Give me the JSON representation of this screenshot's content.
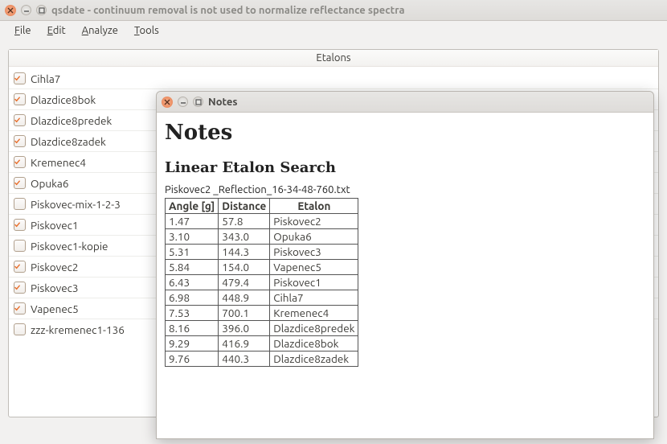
{
  "main_window": {
    "title": "qsdate - continuum removal is not used to normalize reflectance spectra",
    "menu": {
      "file": "File",
      "edit": "Edit",
      "analyze": "Analyze",
      "tools": "Tools"
    },
    "panel_title": "Etalons",
    "etalons": [
      {
        "label": "Cihla7",
        "checked": true
      },
      {
        "label": "Dlazdice8bok",
        "checked": true
      },
      {
        "label": "Dlazdice8predek",
        "checked": true
      },
      {
        "label": "Dlazdice8zadek",
        "checked": true
      },
      {
        "label": "Kremenec4",
        "checked": true
      },
      {
        "label": "Opuka6",
        "checked": true
      },
      {
        "label": "Piskovec-mix-1-2-3",
        "checked": false
      },
      {
        "label": "Piskovec1",
        "checked": true
      },
      {
        "label": "Piskovec1-kopie",
        "checked": false
      },
      {
        "label": "Piskovec2",
        "checked": true
      },
      {
        "label": "Piskovec3",
        "checked": true
      },
      {
        "label": "Vapenec5",
        "checked": true
      },
      {
        "label": "zzz-kremenec1-136",
        "checked": false
      }
    ]
  },
  "dialog": {
    "title": "Notes",
    "heading": "Notes",
    "subheading": "Linear Etalon Search",
    "filename": "Piskovec2 _Reflection_16-34-48-760.txt",
    "columns": [
      "Angle [g]",
      "Distance",
      "Etalon"
    ],
    "rows": [
      {
        "angle": "1.47",
        "distance": "57.8",
        "etalon": "Piskovec2"
      },
      {
        "angle": "3.10",
        "distance": "343.0",
        "etalon": "Opuka6"
      },
      {
        "angle": "5.31",
        "distance": "144.3",
        "etalon": "Piskovec3"
      },
      {
        "angle": "5.84",
        "distance": "154.0",
        "etalon": "Vapenec5"
      },
      {
        "angle": "6.43",
        "distance": "479.4",
        "etalon": "Piskovec1"
      },
      {
        "angle": "6.98",
        "distance": "448.9",
        "etalon": "Cihla7"
      },
      {
        "angle": "7.53",
        "distance": "700.1",
        "etalon": "Kremenec4"
      },
      {
        "angle": "8.16",
        "distance": "396.0",
        "etalon": "Dlazdice8predek"
      },
      {
        "angle": "9.29",
        "distance": "416.9",
        "etalon": "Dlazdice8bok"
      },
      {
        "angle": "9.76",
        "distance": "440.3",
        "etalon": "Dlazdice8zadek"
      }
    ]
  }
}
